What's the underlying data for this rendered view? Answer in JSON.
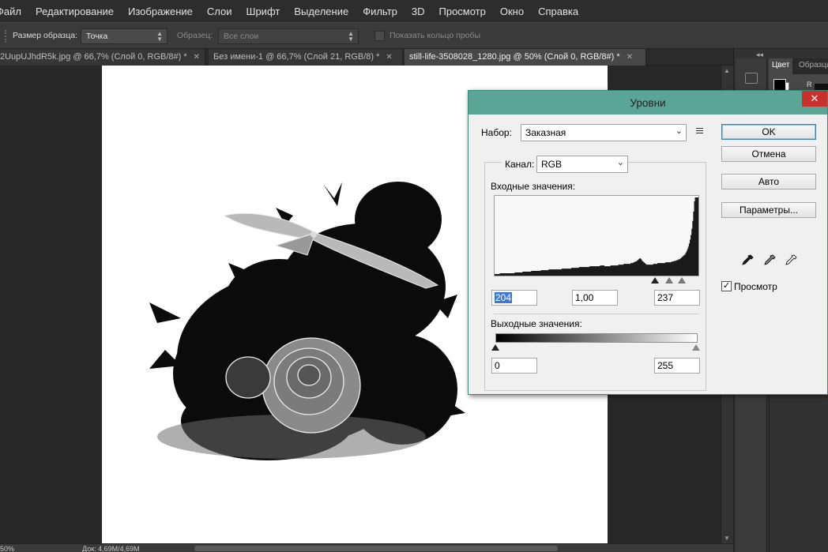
{
  "menu": [
    "Файл",
    "Редактирование",
    "Изображение",
    "Слои",
    "Шрифт",
    "Выделение",
    "Фильтр",
    "3D",
    "Просмотр",
    "Окно",
    "Справка"
  ],
  "options": {
    "sample_size_label": "Размер образца:",
    "sample_size_value": "Точка",
    "sample_label": "Образец:",
    "sample_value": "Все слои",
    "show_ring_label": "Показать кольцо пробы"
  },
  "tabs": [
    {
      "label": "2UupUJhdR5k.jpg @ 66,7% (Слой 0, RGB/8#) *",
      "active": false
    },
    {
      "label": "Без имени-1 @ 66,7% (Слой 21, RGB/8) *",
      "active": false
    },
    {
      "label": "still-life-3508028_1280.jpg @ 50% (Слой 0, RGB/8#) *",
      "active": true
    }
  ],
  "status": {
    "zoom": "50%",
    "doc": "Док: 4,69M/4,69M"
  },
  "panels": {
    "tab_color": "Цвет",
    "tab_swatches": "Образцы",
    "channel_r": "R"
  },
  "dialog": {
    "title": "Уровни",
    "preset_label": "Набор:",
    "preset_value": "Заказная",
    "channel_label": "Канал:",
    "channel_value": "RGB",
    "input_label": "Входные значения:",
    "input_black": "204",
    "input_gamma": "1,00",
    "input_white": "237",
    "output_label": "Выходные значения:",
    "output_black": "0",
    "output_white": "255",
    "buttons": {
      "ok": "OK",
      "cancel": "Отмена",
      "auto": "Авто",
      "options": "Параметры..."
    },
    "preview_label": "Просмотр",
    "preview_checked": true,
    "histogram": [
      2,
      2,
      2,
      2,
      2,
      2,
      3,
      3,
      3,
      3,
      3,
      3,
      3,
      3,
      3,
      3,
      3,
      3,
      3,
      3,
      3,
      3,
      3,
      4,
      4,
      4,
      4,
      4,
      4,
      4,
      4,
      4,
      5,
      5,
      5,
      5,
      5,
      5,
      5,
      5,
      5,
      5,
      6,
      6,
      6,
      6,
      6,
      6,
      6,
      6,
      6,
      6,
      6,
      7,
      7,
      7,
      7,
      7,
      7,
      7,
      7,
      7,
      8,
      8,
      8,
      8,
      8,
      8,
      8,
      8,
      8,
      8,
      8,
      8,
      8,
      8,
      8,
      9,
      9,
      9,
      9,
      9,
      9,
      9,
      9,
      9,
      9,
      9,
      10,
      10,
      10,
      10,
      10,
      10,
      10,
      10,
      10,
      11,
      11,
      11,
      11,
      11,
      11,
      11,
      11,
      11,
      11,
      11,
      11,
      12,
      12,
      12,
      12,
      12,
      12,
      12,
      12,
      12,
      12,
      12,
      12,
      13,
      13,
      13,
      13,
      13,
      12,
      12,
      12,
      12,
      12,
      12,
      12,
      13,
      13,
      13,
      13,
      13,
      13,
      13,
      13,
      13,
      14,
      14,
      14,
      14,
      14,
      14,
      15,
      15,
      15,
      15,
      15,
      15,
      15,
      15,
      16,
      16,
      16,
      17,
      17,
      18,
      18,
      19,
      20,
      21,
      22,
      22,
      21,
      19,
      18,
      17,
      16,
      15,
      14,
      14,
      14,
      14,
      14,
      14,
      14,
      14,
      15,
      15,
      15,
      15,
      15,
      16,
      16,
      16,
      16,
      16,
      16,
      16,
      16,
      16,
      17,
      17,
      17,
      17,
      17,
      17,
      17,
      18,
      18,
      18,
      19,
      19,
      19,
      20,
      20,
      21,
      21,
      22,
      23,
      24,
      25,
      26,
      27,
      29,
      31,
      34,
      37,
      41,
      46,
      52,
      60,
      70,
      82,
      95,
      100,
      100,
      100,
      100
    ]
  }
}
